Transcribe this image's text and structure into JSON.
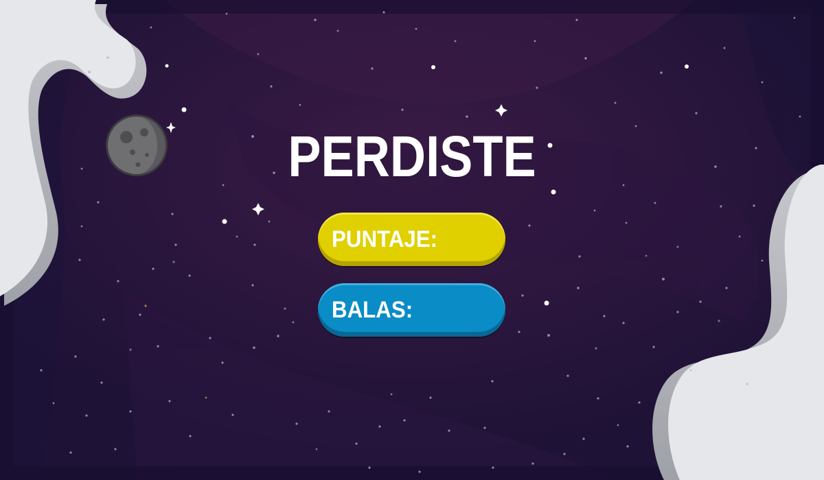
{
  "screen": {
    "title": "PERDISTE",
    "score_label": "PUNTAJE:",
    "bullets_label": "BALAS:"
  },
  "colors": {
    "background_dark": "#1c1236",
    "background_purple": "#33193f",
    "cloud": "#e6e7ea",
    "score_pill": "#e0d000",
    "bullets_pill": "#0a8cc6",
    "moon": "#6f6f72"
  },
  "icons": {
    "moon": "moon-icon",
    "sparkle": "sparkle-star-icon"
  }
}
